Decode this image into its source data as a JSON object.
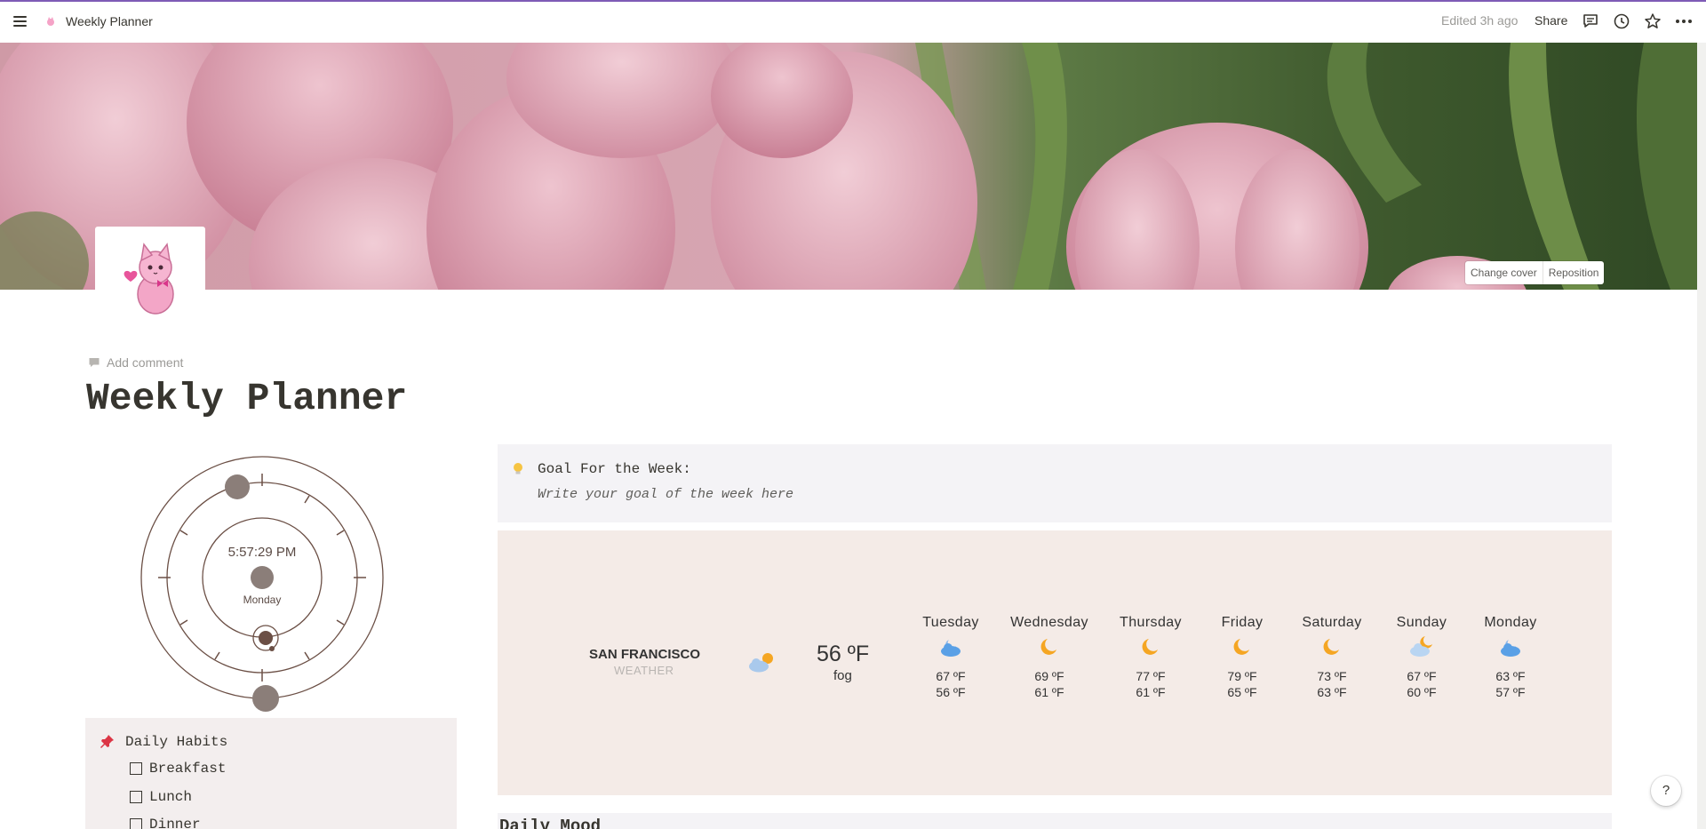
{
  "topbar": {
    "title": "Weekly Planner",
    "edited": "Edited 3h ago",
    "share_label": "Share",
    "icons": [
      "menu-icon",
      "comments-icon",
      "history-icon",
      "star-icon",
      "more-icon"
    ]
  },
  "cover": {
    "change_label": "Change cover",
    "reposition_label": "Reposition"
  },
  "page": {
    "add_comment": "Add comment",
    "title": "Weekly Planner"
  },
  "clock": {
    "time": "5:57:29 PM",
    "day": "Monday"
  },
  "goal": {
    "label": "Goal For the Week:",
    "text": "Write your goal of the week here"
  },
  "weather": {
    "city": "SAN FRANCISCO",
    "subtitle": "WEATHER",
    "current_temp": "56 ºF",
    "condition": "fog",
    "days": [
      {
        "name": "Tuesday",
        "hi": "67 ºF",
        "lo": "56 ºF",
        "icon": "cloud"
      },
      {
        "name": "Wednesday",
        "hi": "69 ºF",
        "lo": "61 ºF",
        "icon": "moon"
      },
      {
        "name": "Thursday",
        "hi": "77 ºF",
        "lo": "61 ºF",
        "icon": "moon"
      },
      {
        "name": "Friday",
        "hi": "79 ºF",
        "lo": "65 ºF",
        "icon": "moon"
      },
      {
        "name": "Saturday",
        "hi": "73 ºF",
        "lo": "63 ºF",
        "icon": "moon"
      },
      {
        "name": "Sunday",
        "hi": "67 ºF",
        "lo": "60 ºF",
        "icon": "cloud-moon"
      },
      {
        "name": "Monday",
        "hi": "63 ºF",
        "lo": "57 ºF",
        "icon": "cloud"
      }
    ]
  },
  "habits": {
    "title": "Daily Habits",
    "items": [
      "Breakfast",
      "Lunch",
      "Dinner"
    ]
  },
  "mood": {
    "title": "Daily Mood"
  },
  "help_label": "?",
  "colors": {
    "accent_strip": "#7e5bb6",
    "weather_bg": "#f4ebe7",
    "goal_bg": "#f4f3f6",
    "habits_bg": "#f3eeee",
    "clock_stroke": "#6b4f45"
  }
}
